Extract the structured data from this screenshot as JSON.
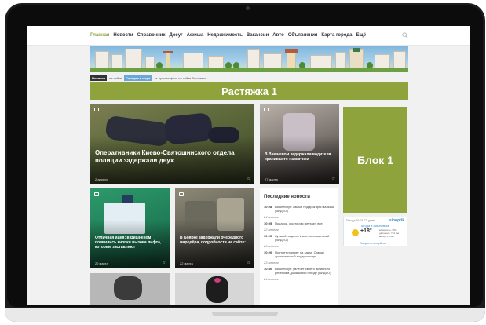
{
  "nav": {
    "items": [
      {
        "label": "Главная",
        "active": true
      },
      {
        "label": "Новости",
        "active": false
      },
      {
        "label": "Справочник",
        "active": false
      },
      {
        "label": "Досуг",
        "active": false
      },
      {
        "label": "Афиша",
        "active": false
      },
      {
        "label": "Недвижимость",
        "active": false
      },
      {
        "label": "Вакансии",
        "active": false
      },
      {
        "label": "Авто",
        "active": false
      },
      {
        "label": "Объявления",
        "active": false
      },
      {
        "label": "Карта города",
        "active": false
      },
      {
        "label": "Ещё",
        "active": false
      }
    ],
    "search_icon": "search-icon"
  },
  "ticker": {
    "tag1": "Новинки",
    "text1": "на сайте",
    "tag2": "Сегодня в мире",
    "text2": "за лучшее фото на сайте Вишневое"
  },
  "stretch": {
    "label": "Растяжка 1"
  },
  "block1": {
    "label": "Блок 1"
  },
  "cards": {
    "main": {
      "title": "Оперативники Киево-Святошинского отдела полиции задержали двух",
      "date": "2 апреля"
    },
    "side": {
      "title": "В Вишневом задержали водителя хранившего наркотики",
      "date": "27 марта"
    },
    "c1": {
      "title": "Отличная идея: в Вишневом появились кнопки вызова лифта, которые заставляют",
      "date": "22 марта"
    },
    "c2": {
      "title": "В Боярке задержали очередного мародёра, подробности на сайте:",
      "date": "22 марта"
    }
  },
  "news": {
    "title": "Последние новости",
    "groups": [
      {
        "date": "",
        "items": [
          {
            "time": "10:28",
            "text": "Вишнеблуs: самый подарок для малыша (ВИДЕО)"
          }
        ]
      },
      {
        "date": "24 апреля",
        "items": [
          {
            "time": "10:05",
            "text": "Подарок, о котором мечтают все"
          }
        ]
      },
      {
        "date": "22 апреля",
        "items": [
          {
            "time": "10:25",
            "text": "Лучший подарок книга воспоминаний (ВИДЕО)"
          }
        ]
      },
      {
        "date": "20 апреля",
        "items": [
          {
            "time": "10:20",
            "text": "Портрет портрет на заказ. Самый оригинальный подарок года"
          }
        ]
      },
      {
        "date": "23 апреля",
        "items": [
          {
            "time": "10:30",
            "text": "Вишнеблуs: увлечет своего активного ребенка в домашнюю погоду (ВИДЕО)"
          }
        ]
      },
      {
        "date": "24 апреля",
        "items": []
      }
    ]
  },
  "weather": {
    "header": "Погода 26.04.17, днем",
    "logo": "sinoptik",
    "city": "Погода в Вишневом",
    "temp": "+18°",
    "stats": [
      "влажность: 38%",
      "давление: 744 мм",
      "ветер: 5.0 м/с,"
    ],
    "link": "Погода на sinoptik.ua"
  }
}
